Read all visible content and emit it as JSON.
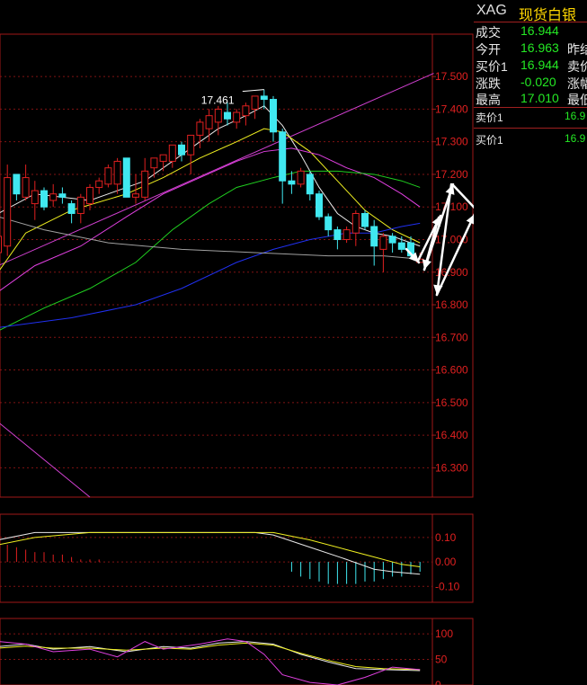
{
  "quote": {
    "symbol": "XAG",
    "name": "现货白银",
    "rows": [
      {
        "label": "成交",
        "value": "16.944",
        "right": ""
      },
      {
        "label": "今开",
        "value": "16.963",
        "right": "昨结"
      },
      {
        "label": "买价1",
        "value": "16.944",
        "right": "卖价"
      },
      {
        "label": "涨跌",
        "value": "-0.020",
        "right": "涨幅"
      },
      {
        "label": "最高",
        "value": "17.010",
        "right": "最低"
      }
    ],
    "orderbook": [
      {
        "label": "卖价1",
        "value": "16.9"
      },
      {
        "label": "买价1",
        "value": "16.9"
      }
    ]
  },
  "colors": {
    "up": "#e02020",
    "down": "#40e8f0",
    "grid": "#a01818",
    "ma5": "#e8e8e8",
    "ma10": "#f0f020",
    "ma20": "#e040e0",
    "ma30": "#20d020",
    "ma60": "#2030f0",
    "ma120": "#a0a0a0",
    "channel": "#d040d0",
    "axis_text": "#e02020"
  },
  "chart_data": [
    {
      "type": "candlestick",
      "title": "",
      "ylim": [
        16.21,
        17.63
      ],
      "yticks": [
        "17.500",
        "17.400",
        "17.300",
        "17.200",
        "17.100",
        "17.000",
        "16.900",
        "16.800",
        "16.700",
        "16.600",
        "16.500",
        "16.400",
        "16.300"
      ],
      "high_annotation": "17.461",
      "candles": [
        [
          16.96,
          17.03,
          16.92,
          17.01
        ],
        [
          16.98,
          17.23,
          16.95,
          17.19
        ],
        [
          17.2,
          17.2,
          17.12,
          17.14
        ],
        [
          17.13,
          17.23,
          17.12,
          17.19
        ],
        [
          17.11,
          17.18,
          17.06,
          17.15
        ],
        [
          17.15,
          17.16,
          17.09,
          17.1
        ],
        [
          17.12,
          17.17,
          17.1,
          17.14
        ],
        [
          17.14,
          17.16,
          17.11,
          17.13
        ],
        [
          17.11,
          17.12,
          17.05,
          17.08
        ],
        [
          17.08,
          17.14,
          17.05,
          17.13
        ],
        [
          17.11,
          17.17,
          17.09,
          17.16
        ],
        [
          17.16,
          17.19,
          17.14,
          17.18
        ],
        [
          17.17,
          17.23,
          17.16,
          17.22
        ],
        [
          17.17,
          17.25,
          17.14,
          17.24
        ],
        [
          17.25,
          17.25,
          17.14,
          17.13
        ],
        [
          17.13,
          17.2,
          17.11,
          17.14
        ],
        [
          17.13,
          17.25,
          17.12,
          17.21
        ],
        [
          17.22,
          17.25,
          17.19,
          17.25
        ],
        [
          17.24,
          17.26,
          17.21,
          17.26
        ],
        [
          17.24,
          17.29,
          17.22,
          17.29
        ],
        [
          17.29,
          17.3,
          17.24,
          17.26
        ],
        [
          17.26,
          17.32,
          17.2,
          17.32
        ],
        [
          17.32,
          17.37,
          17.28,
          17.36
        ],
        [
          17.34,
          17.4,
          17.3,
          17.38
        ],
        [
          17.36,
          17.41,
          17.32,
          17.4
        ],
        [
          17.39,
          17.42,
          17.35,
          17.37
        ],
        [
          17.36,
          17.4,
          17.34,
          17.39
        ],
        [
          17.38,
          17.42,
          17.35,
          17.41
        ],
        [
          17.4,
          17.44,
          17.37,
          17.44
        ],
        [
          17.44,
          17.46,
          17.4,
          17.43
        ],
        [
          17.43,
          17.44,
          17.3,
          17.33
        ],
        [
          17.33,
          17.34,
          17.11,
          17.18
        ],
        [
          17.18,
          17.21,
          17.14,
          17.17
        ],
        [
          17.17,
          17.22,
          17.16,
          17.21
        ],
        [
          17.2,
          17.21,
          17.12,
          17.14
        ],
        [
          17.14,
          17.15,
          17.06,
          17.07
        ],
        [
          17.07,
          17.08,
          17.01,
          17.03
        ],
        [
          17.03,
          17.04,
          16.97,
          17.0
        ],
        [
          17.0,
          17.04,
          16.99,
          17.03
        ],
        [
          17.02,
          17.09,
          16.98,
          17.08
        ],
        [
          17.08,
          17.09,
          17.03,
          17.04
        ],
        [
          17.04,
          17.06,
          16.92,
          16.98
        ],
        [
          16.97,
          17.02,
          16.9,
          17.01
        ],
        [
          17.01,
          17.02,
          16.96,
          16.99
        ],
        [
          16.99,
          17.01,
          16.96,
          16.97
        ],
        [
          16.99,
          17.01,
          16.94,
          16.95
        ],
        [
          16.93,
          16.96,
          16.93,
          16.94
        ]
      ],
      "ma_lines": [
        {
          "key": "ma5",
          "points": [
            [
              0,
              17.08
            ],
            [
              4,
              17.14
            ],
            [
              10,
              17.12
            ],
            [
              16,
              17.18
            ],
            [
              20,
              17.26
            ],
            [
              24,
              17.34
            ],
            [
              27,
              17.38
            ],
            [
              29,
              17.41
            ],
            [
              31,
              17.35
            ],
            [
              33,
              17.26
            ],
            [
              35,
              17.16
            ],
            [
              37,
              17.08
            ],
            [
              39,
              17.04
            ],
            [
              41,
              17.02
            ],
            [
              43,
              17.01
            ],
            [
              46,
              16.98
            ]
          ]
        },
        {
          "key": "ma10",
          "points": [
            [
              0,
              16.9
            ],
            [
              3,
              17.02
            ],
            [
              8,
              17.09
            ],
            [
              14,
              17.14
            ],
            [
              18,
              17.19
            ],
            [
              22,
              17.25
            ],
            [
              26,
              17.3
            ],
            [
              29,
              17.34
            ],
            [
              31,
              17.33
            ],
            [
              34,
              17.27
            ],
            [
              37,
              17.18
            ],
            [
              40,
              17.09
            ],
            [
              43,
              17.03
            ],
            [
              46,
              16.99
            ]
          ]
        },
        {
          "key": "ma20",
          "points": [
            [
              0,
              16.84
            ],
            [
              4,
              16.92
            ],
            [
              9,
              16.98
            ],
            [
              14,
              17.07
            ],
            [
              18,
              17.14
            ],
            [
              22,
              17.19
            ],
            [
              26,
              17.24
            ],
            [
              29,
              17.27
            ],
            [
              32,
              17.28
            ],
            [
              35,
              17.26
            ],
            [
              38,
              17.22
            ],
            [
              41,
              17.19
            ],
            [
              44,
              17.14
            ],
            [
              46,
              17.1
            ]
          ]
        },
        {
          "key": "ma30",
          "points": [
            [
              0,
              16.72
            ],
            [
              5,
              16.79
            ],
            [
              10,
              16.85
            ],
            [
              15,
              16.93
            ],
            [
              19,
              17.03
            ],
            [
              23,
              17.11
            ],
            [
              26,
              17.16
            ],
            [
              30,
              17.19
            ],
            [
              33,
              17.21
            ],
            [
              37,
              17.21
            ],
            [
              41,
              17.2
            ],
            [
              44,
              17.18
            ],
            [
              46,
              17.16
            ]
          ]
        },
        {
          "key": "ma60",
          "points": [
            [
              0,
              16.73
            ],
            [
              8,
              16.76
            ],
            [
              15,
              16.8
            ],
            [
              20,
              16.85
            ],
            [
              26,
              16.93
            ],
            [
              30,
              16.97
            ],
            [
              34,
              17.0
            ],
            [
              38,
              17.02
            ],
            [
              41,
              17.02
            ],
            [
              44,
              17.04
            ],
            [
              46,
              17.05
            ]
          ]
        },
        {
          "key": "ma120",
          "points": [
            [
              0,
              17.07
            ],
            [
              5,
              17.03
            ],
            [
              12,
              16.99
            ],
            [
              20,
              16.97
            ],
            [
              28,
              16.96
            ],
            [
              36,
              16.95
            ],
            [
              42,
              16.95
            ],
            [
              46,
              16.94
            ]
          ]
        }
      ],
      "channel_lines": [
        {
          "points": [
            [
              0,
              16.92
            ],
            [
              47.5,
              17.51
            ]
          ]
        },
        {
          "points": [
            [
              0,
              16.44
            ],
            [
              10,
              16.21
            ]
          ]
        }
      ]
    },
    {
      "type": "bar",
      "title": "",
      "ylim": [
        -0.165,
        0.195
      ],
      "yticks": [
        "0.10",
        "0.00",
        "-0.10"
      ],
      "histogram": [
        0.08,
        0.07,
        0.06,
        0.05,
        0.04,
        0.04,
        0.03,
        0.03,
        0.02,
        0.01,
        0.01,
        0.01,
        0.0,
        0.0,
        0.0,
        0.0,
        0.0,
        0.0,
        0.0,
        0.0,
        0.0,
        0.0,
        0.0,
        0.0,
        0.0,
        0.0,
        0.0,
        0.0,
        0.0,
        0.0,
        0.0,
        0.0,
        -0.04,
        -0.06,
        -0.07,
        -0.08,
        -0.09,
        -0.09,
        -0.09,
        -0.09,
        -0.08,
        -0.08,
        -0.07,
        -0.06,
        -0.06,
        -0.05,
        -0.04
      ],
      "lines": [
        {
          "key": "ma5",
          "points": [
            [
              0,
              0.09
            ],
            [
              4,
              0.12
            ],
            [
              10,
              0.12
            ],
            [
              20,
              0.12
            ],
            [
              28,
              0.12
            ],
            [
              30,
              0.11
            ],
            [
              34,
              0.06
            ],
            [
              38,
              0.01
            ],
            [
              41,
              -0.03
            ],
            [
              43,
              -0.04
            ],
            [
              46,
              -0.05
            ]
          ]
        },
        {
          "key": "ma10",
          "points": [
            [
              0,
              0.07
            ],
            [
              4,
              0.1
            ],
            [
              10,
              0.12
            ],
            [
              20,
              0.12
            ],
            [
              30,
              0.12
            ],
            [
              34,
              0.09
            ],
            [
              38,
              0.05
            ],
            [
              41,
              0.02
            ],
            [
              44,
              -0.01
            ],
            [
              46,
              -0.02
            ]
          ]
        }
      ]
    },
    {
      "type": "line",
      "title": "",
      "ylim": [
        0,
        130
      ],
      "yticks": [
        "100",
        "50",
        "0"
      ],
      "lines": [
        {
          "key": "ma5",
          "points": [
            [
              0,
              75
            ],
            [
              3,
              80
            ],
            [
              6,
              70
            ],
            [
              10,
              75
            ],
            [
              14,
              65
            ],
            [
              18,
              75
            ],
            [
              21,
              72
            ],
            [
              24,
              82
            ],
            [
              27,
              85
            ],
            [
              30,
              80
            ],
            [
              33,
              60
            ],
            [
              36,
              45
            ],
            [
              39,
              32
            ],
            [
              42,
              30
            ],
            [
              46,
              28
            ]
          ]
        },
        {
          "key": "ma10",
          "points": [
            [
              0,
              72
            ],
            [
              3,
              76
            ],
            [
              6,
              72
            ],
            [
              10,
              72
            ],
            [
              14,
              68
            ],
            [
              18,
              72
            ],
            [
              21,
              70
            ],
            [
              24,
              78
            ],
            [
              27,
              82
            ],
            [
              30,
              78
            ],
            [
              33,
              62
            ],
            [
              36,
              48
            ],
            [
              39,
              36
            ],
            [
              42,
              32
            ],
            [
              46,
              30
            ]
          ]
        },
        {
          "key": "ma20",
          "points": [
            [
              0,
              85
            ],
            [
              3,
              80
            ],
            [
              6,
              65
            ],
            [
              10,
              70
            ],
            [
              13,
              55
            ],
            [
              16,
              85
            ],
            [
              18,
              70
            ],
            [
              22,
              80
            ],
            [
              25,
              90
            ],
            [
              27,
              85
            ],
            [
              29,
              60
            ],
            [
              31,
              20
            ],
            [
              34,
              5
            ],
            [
              37,
              0
            ],
            [
              40,
              15
            ],
            [
              43,
              35
            ],
            [
              46,
              30
            ]
          ]
        }
      ]
    }
  ],
  "annotations": {
    "arrow_color": "#ffffff",
    "note": ""
  }
}
